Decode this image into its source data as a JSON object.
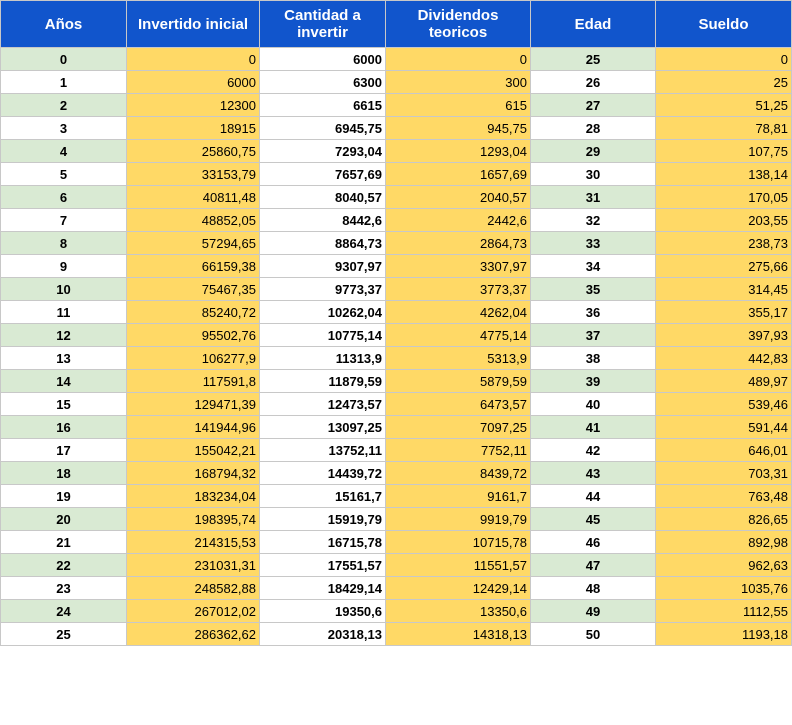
{
  "table": {
    "headers": [
      "Años",
      "Invertido inicial",
      "Cantidad a invertir",
      "Dividendos teoricos",
      "Edad",
      "Sueldo"
    ],
    "rows": [
      [
        "0",
        "0",
        "6000",
        "0",
        "25",
        "0"
      ],
      [
        "1",
        "6000",
        "6300",
        "300",
        "26",
        "25"
      ],
      [
        "2",
        "12300",
        "6615",
        "615",
        "27",
        "51,25"
      ],
      [
        "3",
        "18915",
        "6945,75",
        "945,75",
        "28",
        "78,81"
      ],
      [
        "4",
        "25860,75",
        "7293,04",
        "1293,04",
        "29",
        "107,75"
      ],
      [
        "5",
        "33153,79",
        "7657,69",
        "1657,69",
        "30",
        "138,14"
      ],
      [
        "6",
        "40811,48",
        "8040,57",
        "2040,57",
        "31",
        "170,05"
      ],
      [
        "7",
        "48852,05",
        "8442,6",
        "2442,6",
        "32",
        "203,55"
      ],
      [
        "8",
        "57294,65",
        "8864,73",
        "2864,73",
        "33",
        "238,73"
      ],
      [
        "9",
        "66159,38",
        "9307,97",
        "3307,97",
        "34",
        "275,66"
      ],
      [
        "10",
        "75467,35",
        "9773,37",
        "3773,37",
        "35",
        "314,45"
      ],
      [
        "11",
        "85240,72",
        "10262,04",
        "4262,04",
        "36",
        "355,17"
      ],
      [
        "12",
        "95502,76",
        "10775,14",
        "4775,14",
        "37",
        "397,93"
      ],
      [
        "13",
        "106277,9",
        "11313,9",
        "5313,9",
        "38",
        "442,83"
      ],
      [
        "14",
        "117591,8",
        "11879,59",
        "5879,59",
        "39",
        "489,97"
      ],
      [
        "15",
        "129471,39",
        "12473,57",
        "6473,57",
        "40",
        "539,46"
      ],
      [
        "16",
        "141944,96",
        "13097,25",
        "7097,25",
        "41",
        "591,44"
      ],
      [
        "17",
        "155042,21",
        "13752,11",
        "7752,11",
        "42",
        "646,01"
      ],
      [
        "18",
        "168794,32",
        "14439,72",
        "8439,72",
        "43",
        "703,31"
      ],
      [
        "19",
        "183234,04",
        "15161,7",
        "9161,7",
        "44",
        "763,48"
      ],
      [
        "20",
        "198395,74",
        "15919,79",
        "9919,79",
        "45",
        "826,65"
      ],
      [
        "21",
        "214315,53",
        "16715,78",
        "10715,78",
        "46",
        "892,98"
      ],
      [
        "22",
        "231031,31",
        "17551,57",
        "11551,57",
        "47",
        "962,63"
      ],
      [
        "23",
        "248582,88",
        "18429,14",
        "12429,14",
        "48",
        "1035,76"
      ],
      [
        "24",
        "267012,02",
        "19350,6",
        "13350,6",
        "49",
        "1112,55"
      ],
      [
        "25",
        "286362,62",
        "20318,13",
        "14318,13",
        "50",
        "1193,18"
      ]
    ]
  },
  "colors": {
    "header_bg": "#1155cc",
    "header_text": "#ffffff",
    "highlight_yellow": "#ffd966",
    "band_green": "#d9ead3",
    "grid": "#c8c8c8"
  }
}
